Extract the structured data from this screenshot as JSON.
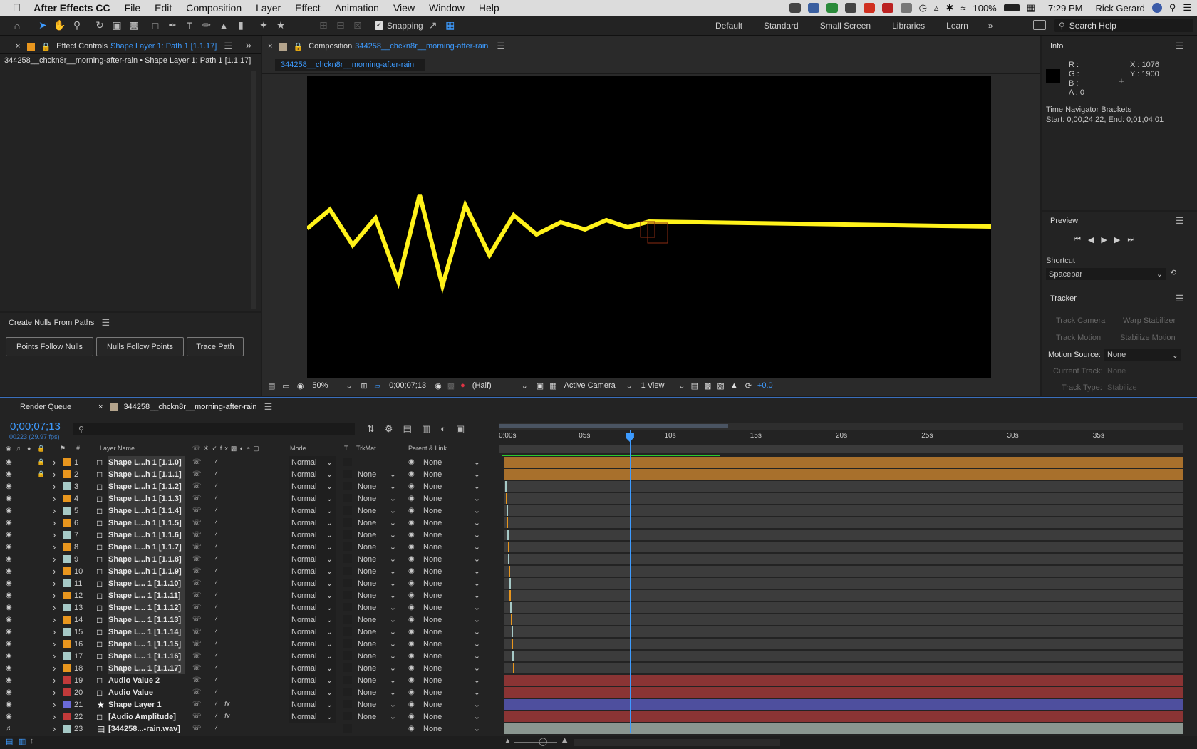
{
  "menubar": {
    "app": "After Effects CC",
    "items": [
      "File",
      "Edit",
      "Composition",
      "Layer",
      "Effect",
      "Animation",
      "View",
      "Window",
      "Help"
    ],
    "battery": "100%",
    "time": "7:29 PM",
    "user": "Rick Gerard"
  },
  "toolbar": {
    "snapping": "Snapping",
    "workspaces": [
      "Default",
      "Standard",
      "Small Screen",
      "Libraries",
      "Learn"
    ],
    "search_placeholder": "Search Help"
  },
  "effect_controls": {
    "tab_prefix": "Effect Controls",
    "tab_layer": "Shape Layer 1: Path 1 [1.1.17]",
    "breadcrumb": "344258__chckn8r__morning-after-rain • Shape Layer 1: Path 1 [1.1.17]"
  },
  "nulls_panel": {
    "title": "Create Nulls From Paths",
    "buttons": [
      "Points Follow Nulls",
      "Nulls Follow Points",
      "Trace Path"
    ]
  },
  "composition": {
    "tab_prefix": "Composition",
    "tab_name": "344258__chckn8r__morning-after-rain",
    "subtab": "344258__chckn8r__morning-after-rain",
    "zoom": "50%",
    "timecode": "0;00;07;13",
    "resolution": "(Half)",
    "camera": "Active Camera",
    "views": "1 View",
    "exposure": "+0.0",
    "line_color": "#fff21a"
  },
  "info": {
    "title": "Info",
    "r": "R :",
    "g": "G :",
    "b": "B :",
    "a": "A :  0",
    "x": "X : 1076",
    "y": "Y : 1900",
    "bracket_title": "Time Navigator Brackets",
    "bracket_range": "Start: 0;00;24;22, End: 0;01;04;01"
  },
  "preview": {
    "title": "Preview",
    "shortcut_label": "Shortcut",
    "shortcut_value": "Spacebar"
  },
  "tracker": {
    "title": "Tracker",
    "track_camera": "Track Camera",
    "warp_stabilizer": "Warp Stabilizer",
    "track_motion": "Track Motion",
    "stabilize_motion": "Stabilize Motion",
    "motion_source_label": "Motion Source:",
    "motion_source_value": "None",
    "current_track_label": "Current Track:",
    "current_track_value": "None",
    "track_type_label": "Track Type:",
    "track_type_value": "Stabilize"
  },
  "timeline": {
    "render_queue": "Render Queue",
    "comp_tab": "344258__chckn8r__morning-after-rain",
    "timecode": "0;00;07;13",
    "frames": "00223 (29.97 fps)",
    "col_num": "#",
    "col_layer": "Layer Name",
    "col_mode": "Mode",
    "col_t": "T",
    "col_trkmat": "TrkMat",
    "col_parent": "Parent & Link",
    "ticks": [
      "0:00s",
      "05s",
      "10s",
      "15s",
      "20s",
      "25s",
      "30s",
      "35s"
    ],
    "playhead_seconds": 7.44,
    "duration_seconds": 40
  },
  "layers": [
    {
      "num": "1",
      "name": "Shape L...h 1 [1.1.0]",
      "color": "#e8961e",
      "mode": "Normal",
      "trkmat": "",
      "parent": "None",
      "lock": true
    },
    {
      "num": "2",
      "name": "Shape L...h 1 [1.1.1]",
      "color": "#e8961e",
      "mode": "Normal",
      "trkmat": "None",
      "parent": "None",
      "lock": true
    },
    {
      "num": "3",
      "name": "Shape L...h 1 [1.1.2]",
      "color": "#a6c9c6",
      "mode": "Normal",
      "trkmat": "None",
      "parent": "None"
    },
    {
      "num": "4",
      "name": "Shape L...h 1 [1.1.3]",
      "color": "#e8961e",
      "mode": "Normal",
      "trkmat": "None",
      "parent": "None"
    },
    {
      "num": "5",
      "name": "Shape L...h 1 [1.1.4]",
      "color": "#a6c9c6",
      "mode": "Normal",
      "trkmat": "None",
      "parent": "None"
    },
    {
      "num": "6",
      "name": "Shape L...h 1 [1.1.5]",
      "color": "#e8961e",
      "mode": "Normal",
      "trkmat": "None",
      "parent": "None"
    },
    {
      "num": "7",
      "name": "Shape L...h 1 [1.1.6]",
      "color": "#a6c9c6",
      "mode": "Normal",
      "trkmat": "None",
      "parent": "None"
    },
    {
      "num": "8",
      "name": "Shape L...h 1 [1.1.7]",
      "color": "#e8961e",
      "mode": "Normal",
      "trkmat": "None",
      "parent": "None"
    },
    {
      "num": "9",
      "name": "Shape L...h 1 [1.1.8]",
      "color": "#a6c9c6",
      "mode": "Normal",
      "trkmat": "None",
      "parent": "None"
    },
    {
      "num": "10",
      "name": "Shape L...h 1 [1.1.9]",
      "color": "#e8961e",
      "mode": "Normal",
      "trkmat": "None",
      "parent": "None"
    },
    {
      "num": "11",
      "name": "Shape L... 1 [1.1.10]",
      "color": "#a6c9c6",
      "mode": "Normal",
      "trkmat": "None",
      "parent": "None"
    },
    {
      "num": "12",
      "name": "Shape L... 1 [1.1.11]",
      "color": "#e8961e",
      "mode": "Normal",
      "trkmat": "None",
      "parent": "None"
    },
    {
      "num": "13",
      "name": "Shape L... 1 [1.1.12]",
      "color": "#a6c9c6",
      "mode": "Normal",
      "trkmat": "None",
      "parent": "None"
    },
    {
      "num": "14",
      "name": "Shape L... 1 [1.1.13]",
      "color": "#e8961e",
      "mode": "Normal",
      "trkmat": "None",
      "parent": "None"
    },
    {
      "num": "15",
      "name": "Shape L... 1 [1.1.14]",
      "color": "#a6c9c6",
      "mode": "Normal",
      "trkmat": "None",
      "parent": "None"
    },
    {
      "num": "16",
      "name": "Shape L... 1 [1.1.15]",
      "color": "#e8961e",
      "mode": "Normal",
      "trkmat": "None",
      "parent": "None"
    },
    {
      "num": "17",
      "name": "Shape L... 1 [1.1.16]",
      "color": "#a6c9c6",
      "mode": "Normal",
      "trkmat": "None",
      "parent": "None"
    },
    {
      "num": "18",
      "name": "Shape L... 1 [1.1.17]",
      "color": "#e8961e",
      "mode": "Normal",
      "trkmat": "None",
      "parent": "None"
    },
    {
      "num": "19",
      "name": "Audio Value 2",
      "color": "#c23a3a",
      "mode": "Normal",
      "trkmat": "None",
      "parent": "None"
    },
    {
      "num": "20",
      "name": "Audio Value",
      "color": "#c23a3a",
      "mode": "Normal",
      "trkmat": "None",
      "parent": "None"
    },
    {
      "num": "21",
      "name": "Shape Layer 1",
      "color": "#6a6ad8",
      "mode": "Normal",
      "trkmat": "None",
      "parent": "None",
      "star": true
    },
    {
      "num": "22",
      "name": "[Audio Amplitude]",
      "color": "#c23a3a",
      "mode": "Normal",
      "trkmat": "None",
      "parent": "None"
    },
    {
      "num": "23",
      "name": "[344258...-rain.wav]",
      "color": "#a6c9c6",
      "mode": "",
      "trkmat": "",
      "parent": "None"
    }
  ]
}
